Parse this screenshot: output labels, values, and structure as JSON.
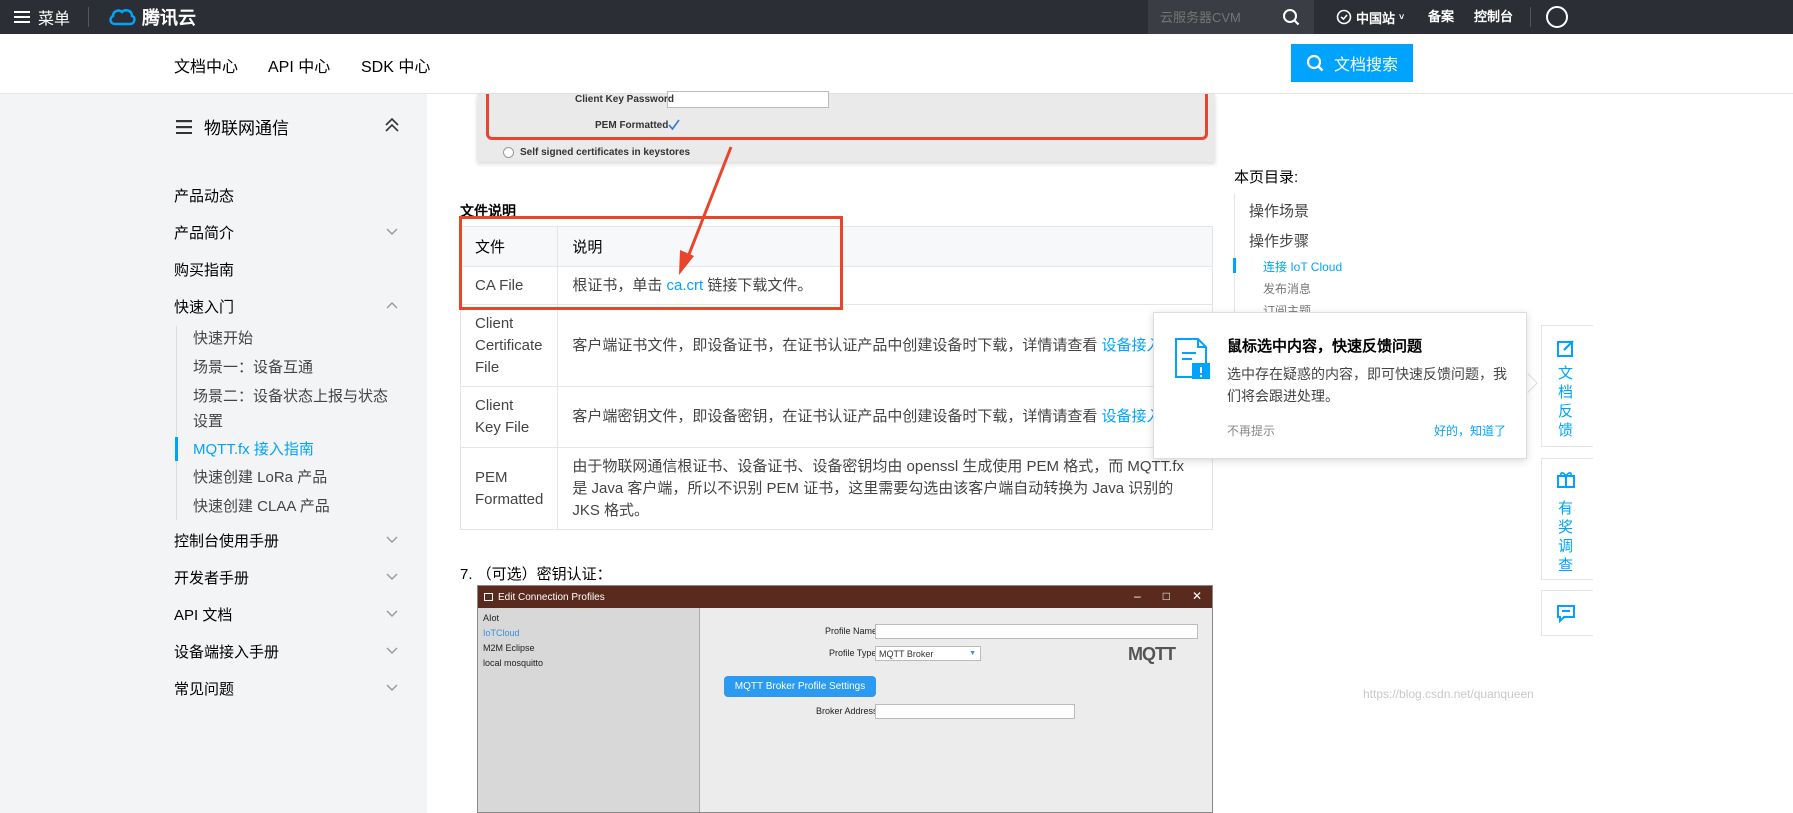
{
  "topbar": {
    "menu_label": "菜单",
    "logo_text": "腾讯云",
    "search_placeholder": "云服务器CVM",
    "region": "中国站",
    "links": [
      "备案",
      "控制台"
    ]
  },
  "subnav": {
    "items": [
      "文档中心",
      "API 中心",
      "SDK 中心"
    ],
    "search_button": "文档搜索"
  },
  "sidebar": {
    "title": "物联网通信",
    "items": [
      {
        "label": "产品动态",
        "expandable": false
      },
      {
        "label": "产品简介",
        "expandable": true
      },
      {
        "label": "购买指南",
        "expandable": false
      },
      {
        "label": "快速入门",
        "expandable": true,
        "expanded": true
      },
      {
        "label": "控制台使用手册",
        "expandable": true
      },
      {
        "label": "开发者手册",
        "expandable": true
      },
      {
        "label": "API 文档",
        "expandable": true
      },
      {
        "label": "设备端接入手册",
        "expandable": true
      },
      {
        "label": "常见问题",
        "expandable": true
      }
    ],
    "sub_items": [
      "快速开始",
      "场景一：设备互通",
      "场景二：设备状态上报与状态设置",
      "MQTT.fx 接入指南",
      "快速创建 LoRa 产品",
      "快速创建 CLAA 产品"
    ],
    "active_sub": "MQTT.fx 接入指南"
  },
  "screenshot_top": {
    "client_key_password_label": "Client Key Password",
    "pem_formatted_label": "PEM Formatted",
    "self_signed_label": "Self signed certificates in keystores"
  },
  "main": {
    "section_title": "文件说明",
    "table": {
      "headers": [
        "文件",
        "说明"
      ],
      "rows": [
        {
          "file": "CA File",
          "desc_prefix": "根证书，单击 ",
          "desc_link": "ca.crt",
          "desc_suffix": " 链接下载文件。"
        },
        {
          "file": "Client Certificate File",
          "desc_prefix": "客户端证书文件，即设备证书，在证书认证产品中创建设备时下载，详情请查看 ",
          "desc_link": "设备接入准备"
        },
        {
          "file": "Client Key File",
          "desc_prefix": "客户端密钥文件，即设备密钥，在证书认证产品中创建设备时下载，详情请查看 ",
          "desc_link": "设备接入准备"
        },
        {
          "file": "PEM Formatted",
          "desc_prefix": "由于物联网通信根证书、设备证书、设备密钥均由 openssl 生成使用 PEM 格式，而 MQTT.fx 是 Java 客户端，所以不识别 PEM 证书，这里需要勾选由该客户端自动转换为 Java 识别的 JKS 格式。"
        }
      ]
    },
    "step7": "7. （可选）密钥认证："
  },
  "app_window": {
    "title": "Edit Connection Profiles",
    "profiles": [
      "AIot",
      "IoTCloud",
      "M2M Eclipse",
      "local mosquitto"
    ],
    "selected_profile": "IoTCloud",
    "profile_name_label": "Profile Name",
    "profile_type_label": "Profile Type",
    "profile_type_value": "MQTT Broker",
    "logo": "MQTT",
    "settings_button": "MQTT Broker Profile Settings",
    "broker_address_label": "Broker Address"
  },
  "watermark": "https://blog.csdn.net/quanqueen",
  "toc": {
    "title": "本页目录:",
    "items": [
      "操作场景",
      "操作步骤"
    ],
    "sub_items": [
      "连接 IoT Cloud",
      "发布消息",
      "订阅主题"
    ],
    "active": "连接 IoT Cloud"
  },
  "popup": {
    "title": "鼠标选中内容，快速反馈问题",
    "text": "选中存在疑惑的内容，即可快速反馈问题，我们将会跟进处理。",
    "dismiss": "不再提示",
    "ok": "好的，知道了"
  },
  "float_tools": {
    "feedback": "文档反馈",
    "survey": "有奖调查"
  },
  "colors": {
    "accent": "#00a4ff",
    "highlight_red": "#e8452c",
    "topbar": "#2b2e34"
  }
}
